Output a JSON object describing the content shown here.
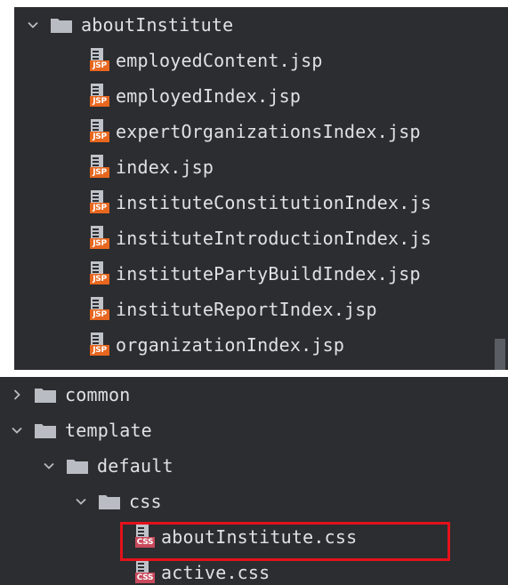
{
  "top_tree": {
    "folder": {
      "label": "aboutInstitute",
      "expanded": true
    },
    "files": [
      {
        "label": "employedContent.jsp",
        "type_badge": "JSP"
      },
      {
        "label": "employedIndex.jsp",
        "type_badge": "JSP"
      },
      {
        "label": "expertOrganizationsIndex.jsp",
        "type_badge": "JSP"
      },
      {
        "label": "index.jsp",
        "type_badge": "JSP"
      },
      {
        "label": "instituteConstitutionIndex.js",
        "type_badge": "JSP"
      },
      {
        "label": "instituteIntroductionIndex.js",
        "type_badge": "JSP"
      },
      {
        "label": "institutePartyBuildIndex.jsp",
        "type_badge": "JSP"
      },
      {
        "label": "instituteReportIndex.jsp",
        "type_badge": "JSP"
      },
      {
        "label": "organizationIndex.jsp",
        "type_badge": "JSP"
      }
    ]
  },
  "bottom_tree": {
    "folders": [
      {
        "label": "common",
        "expanded": false
      },
      {
        "label": "template",
        "expanded": true
      },
      {
        "label": "default",
        "expanded": true
      },
      {
        "label": "css",
        "expanded": true
      }
    ],
    "files": [
      {
        "label": "aboutInstitute.css",
        "type_badge": "CSS",
        "highlighted": true
      },
      {
        "label": "active.css",
        "type_badge": "CSS"
      }
    ]
  },
  "colors": {
    "panel_background": "#2b2d30",
    "text": "#dfe1e5",
    "folder_icon": "#b9bcc2",
    "jsp_badge": "#e8671f",
    "css_badge": "#c94a5d",
    "highlight_border": "#e3121b"
  },
  "icons": {
    "expanded": "chevron-down-icon",
    "collapsed": "chevron-right-icon",
    "folder": "folder-icon",
    "jsp_file": "jsp-file-icon",
    "css_file": "css-file-icon"
  }
}
